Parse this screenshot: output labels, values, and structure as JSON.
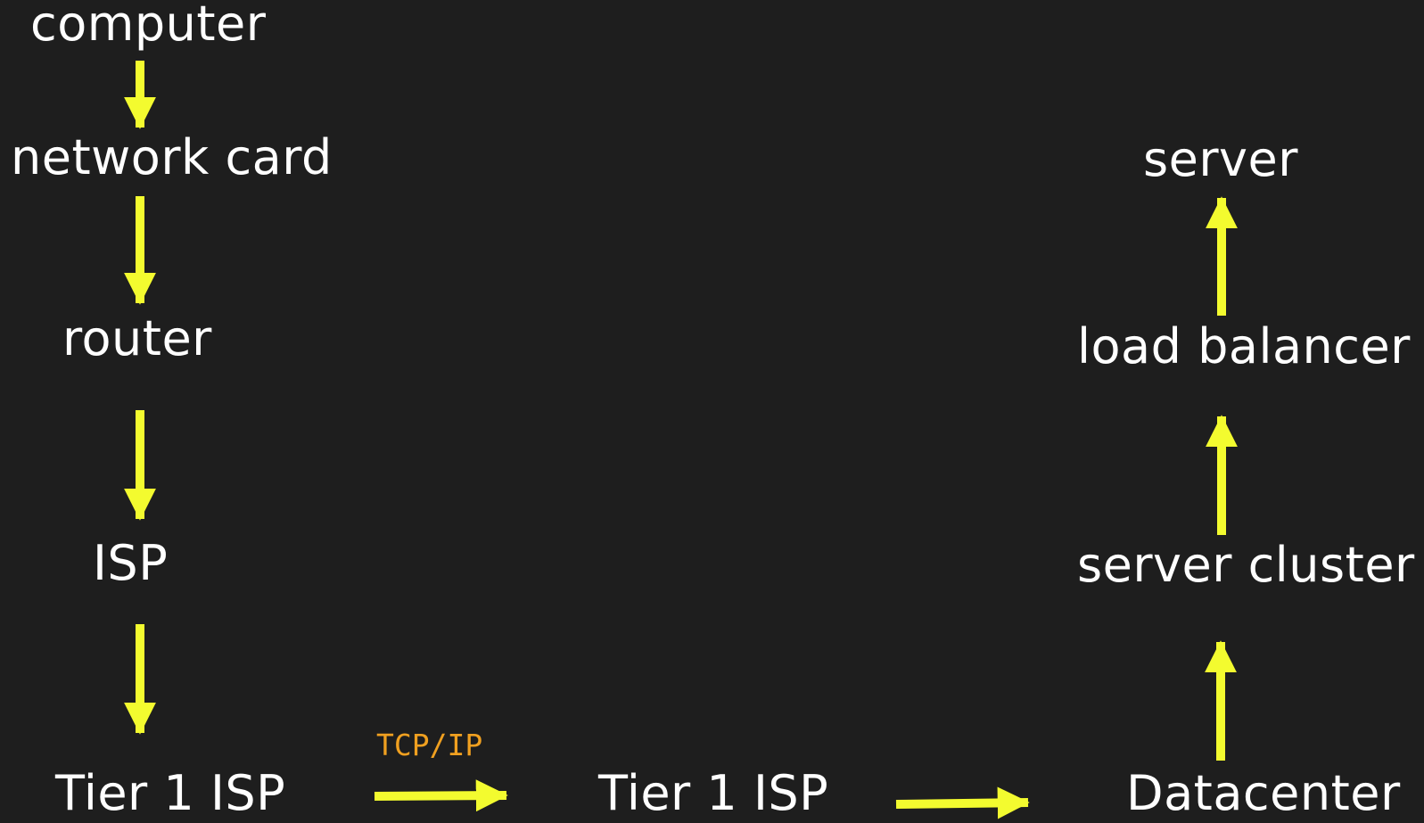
{
  "colors": {
    "background": "#1e1e1e",
    "text": "#ffffff",
    "arrow": "#f3fb2f",
    "protocol_label": "#f0a020"
  },
  "nodes": {
    "computer": "computer",
    "network_card": "network card",
    "router": "router",
    "isp": "ISP",
    "tier1_isp_a": "Tier 1 ISP",
    "tier1_isp_b": "Tier 1 ISP",
    "datacenter": "Datacenter",
    "server_cluster": "server cluster",
    "load_balancer": "load balancer",
    "server": "server"
  },
  "edges": [
    {
      "from": "computer",
      "to": "network card"
    },
    {
      "from": "network card",
      "to": "router"
    },
    {
      "from": "router",
      "to": "ISP"
    },
    {
      "from": "ISP",
      "to": "Tier 1 ISP"
    },
    {
      "from": "Tier 1 ISP",
      "to": "Tier 1 ISP",
      "label": "TCP/IP"
    },
    {
      "from": "Tier 1 ISP",
      "to": "Datacenter"
    },
    {
      "from": "Datacenter",
      "to": "server cluster"
    },
    {
      "from": "server cluster",
      "to": "load balancer"
    },
    {
      "from": "load balancer",
      "to": "server"
    }
  ],
  "protocol_label": "TCP/IP"
}
